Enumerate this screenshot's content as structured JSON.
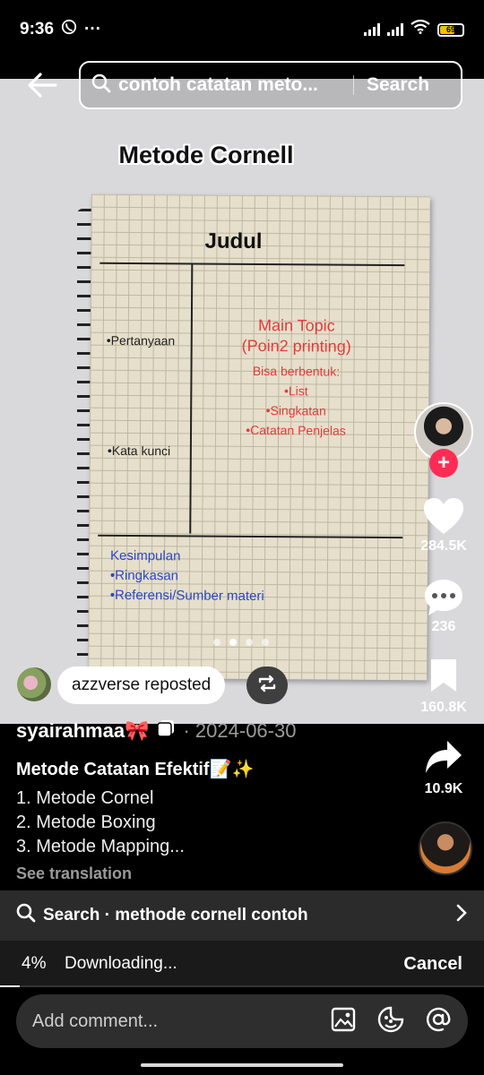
{
  "status_bar": {
    "time": "9:36",
    "battery": "69",
    "more": "···"
  },
  "search": {
    "query": "contoh catatan meto...",
    "button_label": "Search"
  },
  "video": {
    "title": "Metode Cornell",
    "notebook": {
      "heading": "Judul",
      "cue_1": "•Pertanyaan",
      "cue_2": "•Kata kunci",
      "main_topic_1": "Main Topic",
      "main_topic_2": "(Poin2 printing)",
      "main_sub": "Bisa berbentuk:",
      "main_item_1": "•List",
      "main_item_2": "•Singkatan",
      "main_item_3": "•Catatan Penjelas",
      "summary_title": "Kesimpulan",
      "summary_item_1": "•Ringkasan",
      "summary_item_2": "•Referensi/Sumber materi"
    },
    "carousel": {
      "count": 4,
      "active_index": 1
    }
  },
  "rail": {
    "likes": "284.5K",
    "comments": "236",
    "saves": "160.8K",
    "shares": "10.9K",
    "follow": "+"
  },
  "repost": {
    "label": "azzverse reposted"
  },
  "post": {
    "author": "syairahmaa🎀",
    "date": "· 2024-06-30",
    "title": "Metode Catatan Efektif📝✨",
    "lines": [
      "1. Metode Cornel",
      "2. Metode Boxing",
      "3. Metode Mapping..."
    ],
    "see_translation": "See translation"
  },
  "related_search": {
    "label": "Search · methode cornell contoh"
  },
  "download": {
    "percent": "4%",
    "status": "Downloading...",
    "cancel": "Cancel",
    "progress": 0.04
  },
  "comment_bar": {
    "placeholder": "Add comment..."
  }
}
